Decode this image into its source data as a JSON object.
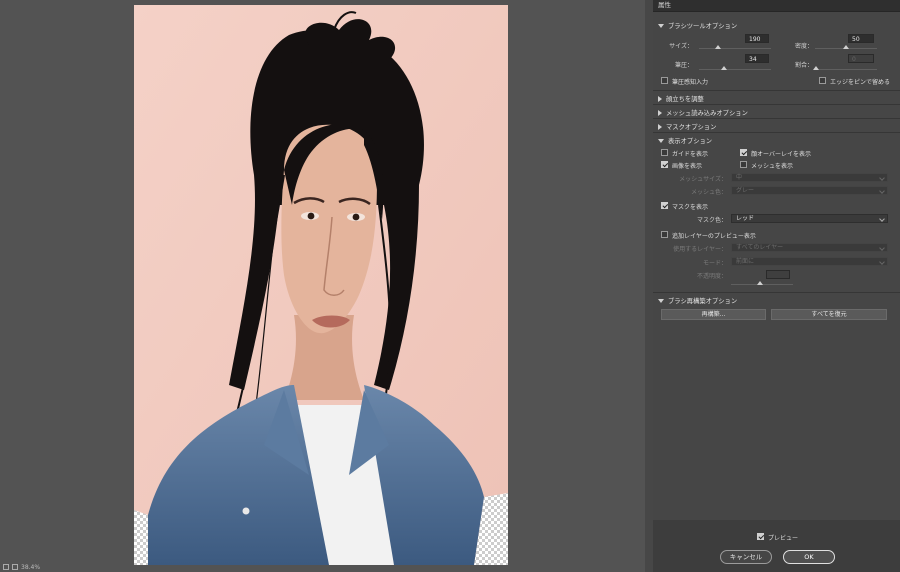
{
  "panel": {
    "title": "属性",
    "brush_options": {
      "heading": "ブラシツールオプション",
      "size_label": "サイズ：",
      "size_value": "190",
      "density_label": "密度：",
      "density_value": "50",
      "pressure_label": "筆圧：",
      "pressure_value": "34",
      "rate_label": "割合：",
      "rate_value": "0",
      "stylus_label": "筆圧感知入力",
      "pin_edges_label": "エッジをピンで留める"
    },
    "face_aware": {
      "heading": "顔立ちを調整"
    },
    "mesh_load": {
      "heading": "メッシュ読み込みオプション"
    },
    "mask_options": {
      "heading": "マスクオプション"
    },
    "view_options": {
      "heading": "表示オプション",
      "show_guides": "ガイドを表示",
      "show_face_overlay": "顔オーバーレイを表示",
      "show_image": "画像を表示",
      "show_mesh": "メッシュを表示",
      "mesh_size_label": "メッシュサイズ：",
      "mesh_size_value": "中",
      "mesh_color_label": "メッシュ色：",
      "mesh_color_value": "グレー",
      "show_mask": "マスクを表示",
      "mask_color_label": "マスク色：",
      "mask_color_value": "レッド",
      "show_backdrop": "追加レイヤーのプレビュー表示",
      "use_layer_label": "使用するレイヤー：",
      "use_layer_value": "すべてのレイヤー",
      "mode_label": "モード：",
      "mode_value": "前面に",
      "opacity_label": "不透明度："
    },
    "reconstruct": {
      "heading": "ブラシ再構築オプション",
      "reconstruct_button": "再構築...",
      "restore_all_button": "すべてを復元"
    },
    "preview_label": "プレビュー",
    "cancel_button": "キャンセル",
    "ok_button": "OK"
  },
  "status": {
    "zoom": "38.4%"
  },
  "colors": {
    "backdrop": "#f2cbc0",
    "hair": "#141010",
    "jacket": "#4f6d92",
    "workspace": "#535353"
  }
}
